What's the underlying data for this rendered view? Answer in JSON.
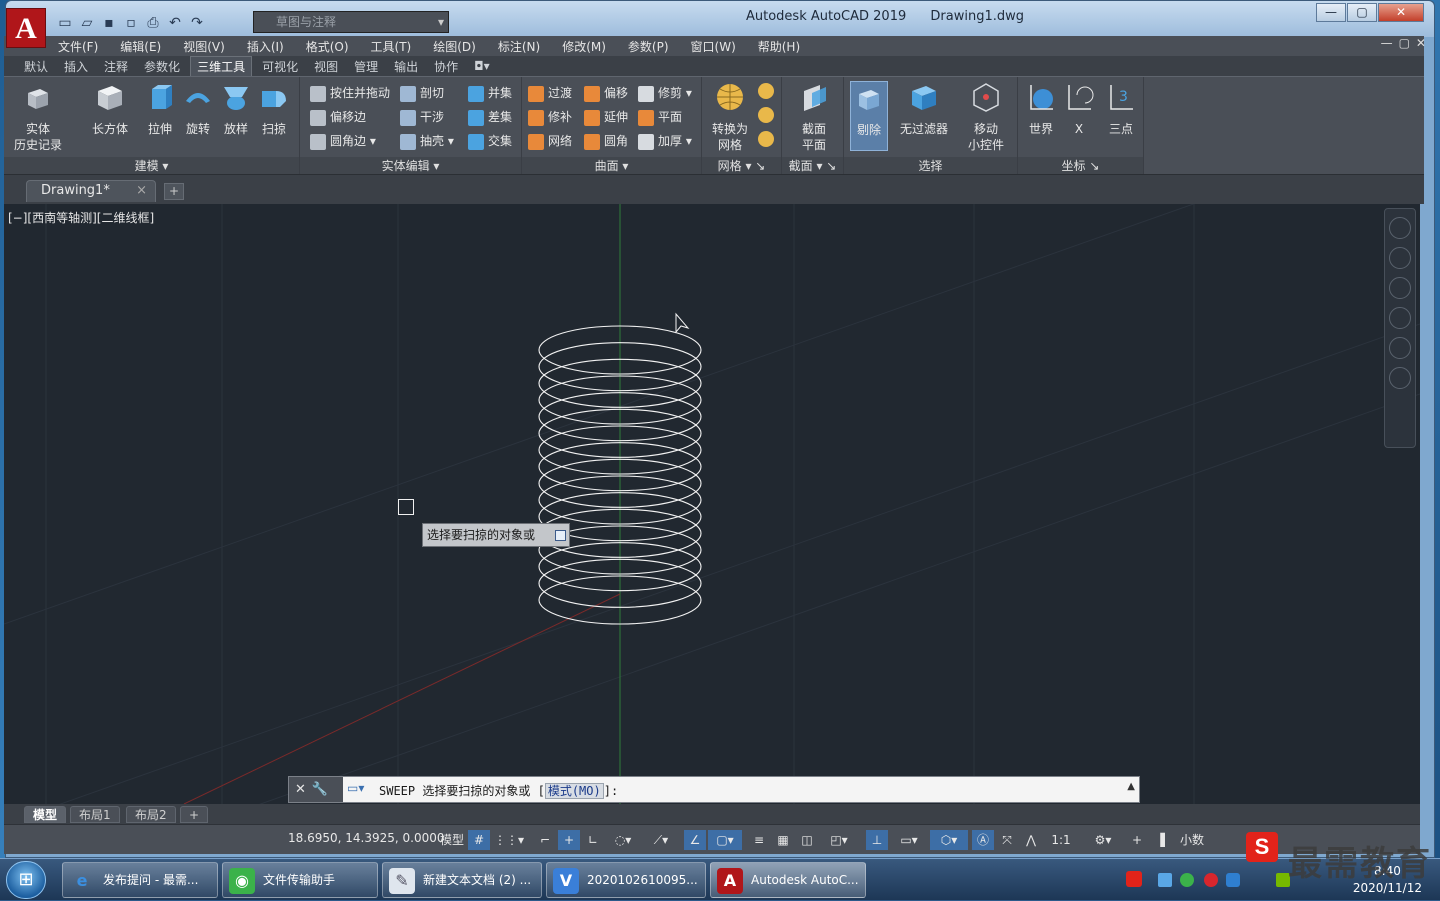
{
  "app": {
    "title": "Autodesk AutoCAD 2019",
    "file": "Drawing1.dwg",
    "logo": "A",
    "workspace_placeholder": "草图与注释"
  },
  "menu": [
    "文件(F)",
    "编辑(E)",
    "视图(V)",
    "插入(I)",
    "格式(O)",
    "工具(T)",
    "绘图(D)",
    "标注(N)",
    "修改(M)",
    "参数(P)",
    "窗口(W)",
    "帮助(H)"
  ],
  "ribbon_tabs": [
    "默认",
    "插入",
    "注释",
    "参数化",
    "三维工具",
    "可视化",
    "视图",
    "管理",
    "输出",
    "协作"
  ],
  "ribbon_active": "三维工具",
  "panels": {
    "modeling": {
      "title": "建模",
      "solid_history": "实体\n历史记录",
      "box": "长方体",
      "extrude": "拉伸",
      "revolve": "旋转",
      "loft": "放样",
      "sweep": "扫掠"
    },
    "solid_edit": {
      "title": "实体编辑",
      "presspull": "按住并拖动",
      "offset_edge": "偏移边",
      "fillet_edge": "圆角边",
      "slice": "剖切",
      "interfere": "干涉",
      "shell": "抽壳",
      "union": "并集",
      "subtract": "差集",
      "intersect": "交集"
    },
    "surface": {
      "title": "曲面",
      "blend": "过渡",
      "patch": "修补",
      "network": "网络",
      "offset": "偏移",
      "extend": "延伸",
      "fillet": "圆角",
      "trim": "修剪",
      "planar": "平面",
      "thicken": "加厚"
    },
    "mesh": {
      "title": "网格",
      "convert": "转换为\n网格"
    },
    "section": {
      "title": "截面",
      "plane": "截面\n平面"
    },
    "selection": {
      "title": "选择",
      "culling": "剔除",
      "no_filter": "无过滤器",
      "gizmo": "移动\n小控件"
    },
    "ucs": {
      "title": "坐标",
      "world": "世界",
      "x": "X",
      "three_point": "三点"
    }
  },
  "filetab": {
    "name": "Drawing1*",
    "close": "×",
    "add": "+"
  },
  "viewport_label": "[−][西南等轴测][二维线框]",
  "tooltip": "选择要扫掠的对象或",
  "command": {
    "prefix": "SWEEP 选择要扫掠的对象或 [",
    "option": "模式(MO)",
    "suffix": "]:"
  },
  "layout_tabs": [
    "模型",
    "布局1",
    "布局2",
    "+"
  ],
  "status": {
    "coords": "18.6950, 14.3925, 0.0000",
    "model": "模型",
    "scale": "1:1",
    "units": "小数"
  },
  "taskbar": {
    "items": [
      {
        "label": "发布提问 - 最需...",
        "icon": "ie-icon"
      },
      {
        "label": "文件传输助手",
        "icon": "wechat-icon"
      },
      {
        "label": "新建文本文档 (2) ...",
        "icon": "notepad-icon"
      },
      {
        "label": "2020102610095...",
        "icon": "video-icon"
      },
      {
        "label": "Autodesk AutoC...",
        "icon": "autocad-icon"
      }
    ],
    "time": "8:40",
    "date": "2020/11/12"
  },
  "watermark": {
    "logo": "S",
    "text": "最需教育"
  },
  "colors": {
    "canvas": "#212830",
    "ribbon": "#4a4f57",
    "accent": "#3d6ea6",
    "y_axis": "#2f7d3a",
    "x_axis": "#7a2a2a"
  }
}
